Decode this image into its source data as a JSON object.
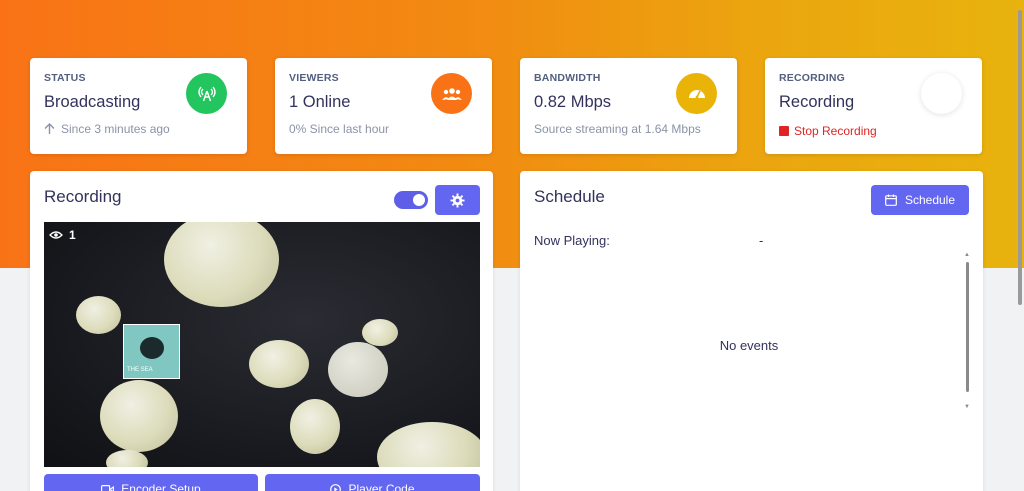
{
  "stats": [
    {
      "label": "STATUS",
      "value": "Broadcasting",
      "sub": "Since 3 minutes ago",
      "icon": "broadcast-icon",
      "color": "#22c55e"
    },
    {
      "label": "VIEWERS",
      "value": "1 Online",
      "sub": "0% Since last hour",
      "icon": "users-icon",
      "color": "#f97316"
    },
    {
      "label": "BANDWIDTH",
      "value": "0.82 Mbps",
      "sub": "Source streaming at 1.64 Mbps",
      "icon": "gauge-icon",
      "color": "#eab308"
    },
    {
      "label": "RECORDING",
      "value": "Recording",
      "sub": "Stop Recording",
      "icon": "record-icon",
      "color": "#ffffff"
    }
  ],
  "recording_panel": {
    "title": "Recording",
    "toggle_on": true,
    "viewer_count": "1",
    "thumb_label": "THE SEA",
    "buttons": {
      "encoder": "Encoder Setup",
      "player": "Player Code"
    }
  },
  "schedule_panel": {
    "title": "Schedule",
    "button": "Schedule",
    "now_playing_label": "Now Playing:",
    "now_playing_value": "-",
    "empty": "No events"
  },
  "colors": {
    "accent": "#6366f1",
    "danger": "#e02424"
  }
}
